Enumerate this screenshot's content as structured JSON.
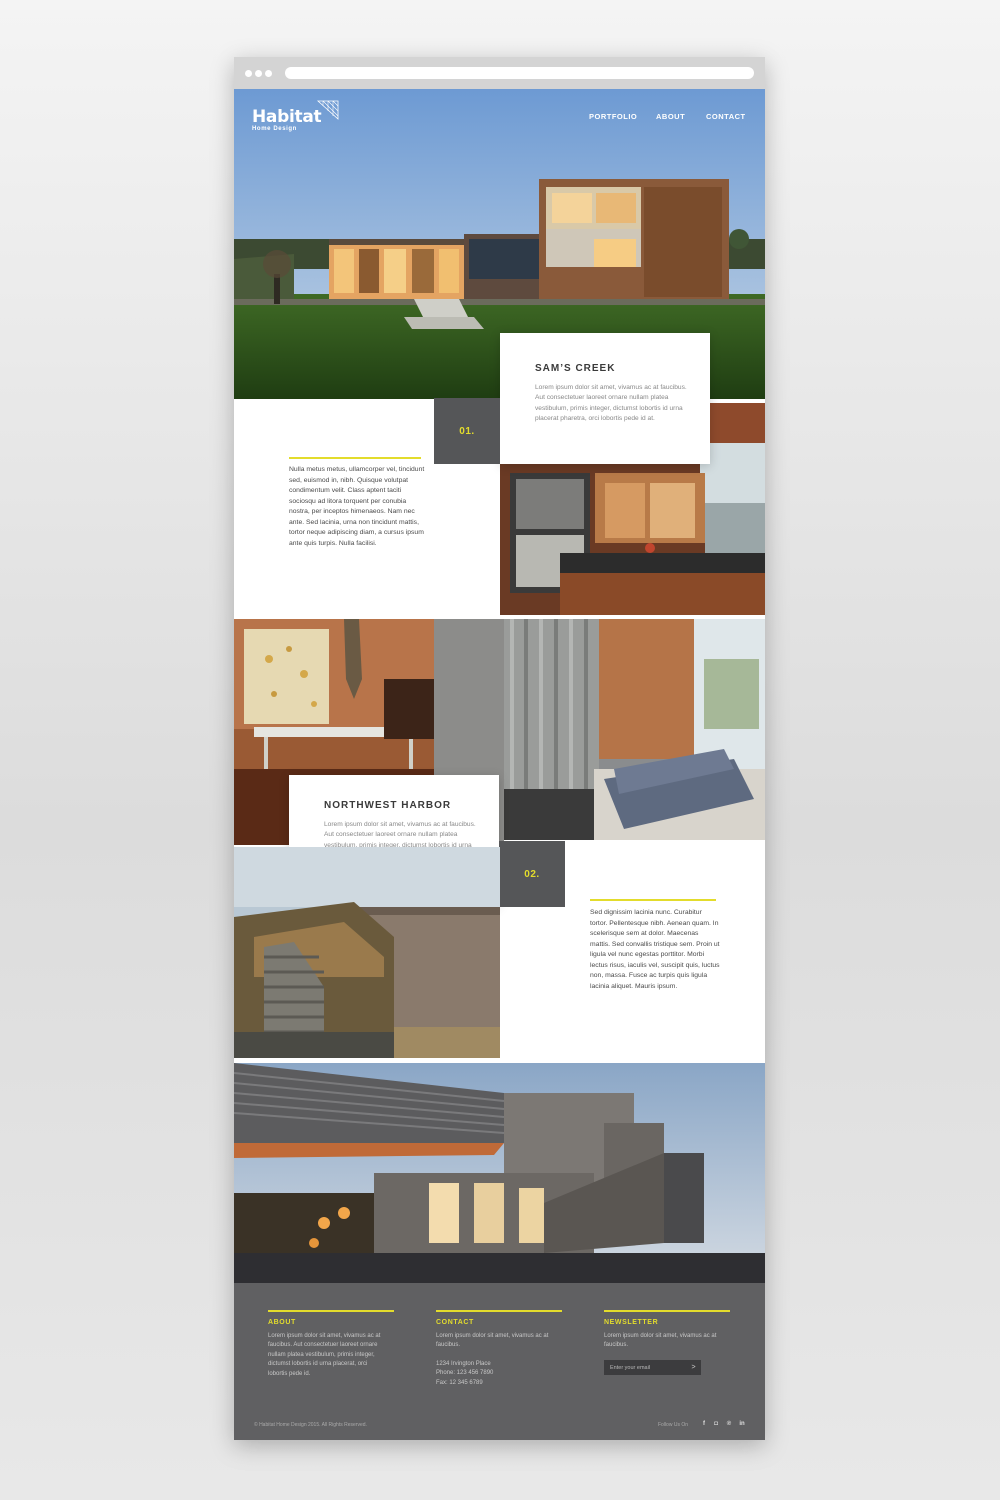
{
  "browser": {
    "url": ""
  },
  "brand": {
    "name": "Habitat",
    "tagline": "Home Design",
    "accent_color": "#e3dc2c",
    "dark_color": "#555658"
  },
  "nav": {
    "items": [
      "PORTFOLIO",
      "ABOUT",
      "CONTACT"
    ]
  },
  "projects": [
    {
      "number": "01.",
      "title": "SAM’S CREEK",
      "summary": "Lorem ipsum dolor sit amet, vivamus ac at faucibus. Aut consectetuer laoreet ornare nullam platea vestibulum, primis integer, dictumst lobortis id urna placerat pharetra, orci lobortis pede id at.",
      "description": "Nulla metus metus, ullamcorper vel, tincidunt sed, euismod in, nibh. Quisque volutpat condimentum velit. Class aptent taciti sociosqu ad litora torquent per conubia nostra, per inceptos himenaeos. Nam nec ante. Sed lacinia, urna non tincidunt mattis, tortor neque adipiscing diam, a cursus ipsum ante quis turpis. Nulla facilisi."
    },
    {
      "number": "02.",
      "title": "NORTHWEST HARBOR",
      "summary": "Lorem ipsum dolor sit amet, vivamus ac at faucibus. Aut consectetuer laoreet ornare nullam platea vestibulum, primis integer, dictumst lobortis id urna placerat pharetra, orci lobortis pede id at. Laoreet sed suscipit phasellus pellentesque.",
      "description": "Sed dignissim lacinia nunc. Curabitur tortor. Pellentesque nibh. Aenean quam. In scelerisque sem at dolor. Maecenas mattis. Sed convallis tristique sem. Proin ut ligula vel nunc egestas porttitor. Morbi lectus risus, iaculis vel, suscipit quis, luctus non, massa. Fusce ac turpis quis ligula lacinia aliquet. Mauris ipsum."
    }
  ],
  "footer": {
    "about": {
      "heading": "ABOUT",
      "text": "Lorem ipsum dolor sit amet, vivamus ac at faucibus. Aut consectetuer laoreet ornare nullam platea vestibulum, primis integer, dictumst lobortis id urna placerat, orci lobortis pede id."
    },
    "contact": {
      "heading": "CONTACT",
      "text": "Lorem ipsum dolor sit amet, vivamus ac at faucibus.",
      "address": "1234 Irvington Place",
      "phone": "Phone: 123 456 7890",
      "fax": "Fax: 12 345 6789"
    },
    "newsletter": {
      "heading": "NEWSLETTER",
      "text": "Lorem ipsum dolor sit amet, vivamus ac at faucibus.",
      "email_placeholder": "Enter your email",
      "submit": ">"
    },
    "copyright": "© Habitat Home Design 2015. All Rights Reserved.",
    "follow_label": "Follow Us On",
    "social_icons": [
      "facebook-icon",
      "instagram-icon",
      "pinterest-icon",
      "linkedin-icon"
    ],
    "social_glyphs": [
      "f",
      "◘",
      "℗",
      "in"
    ]
  }
}
